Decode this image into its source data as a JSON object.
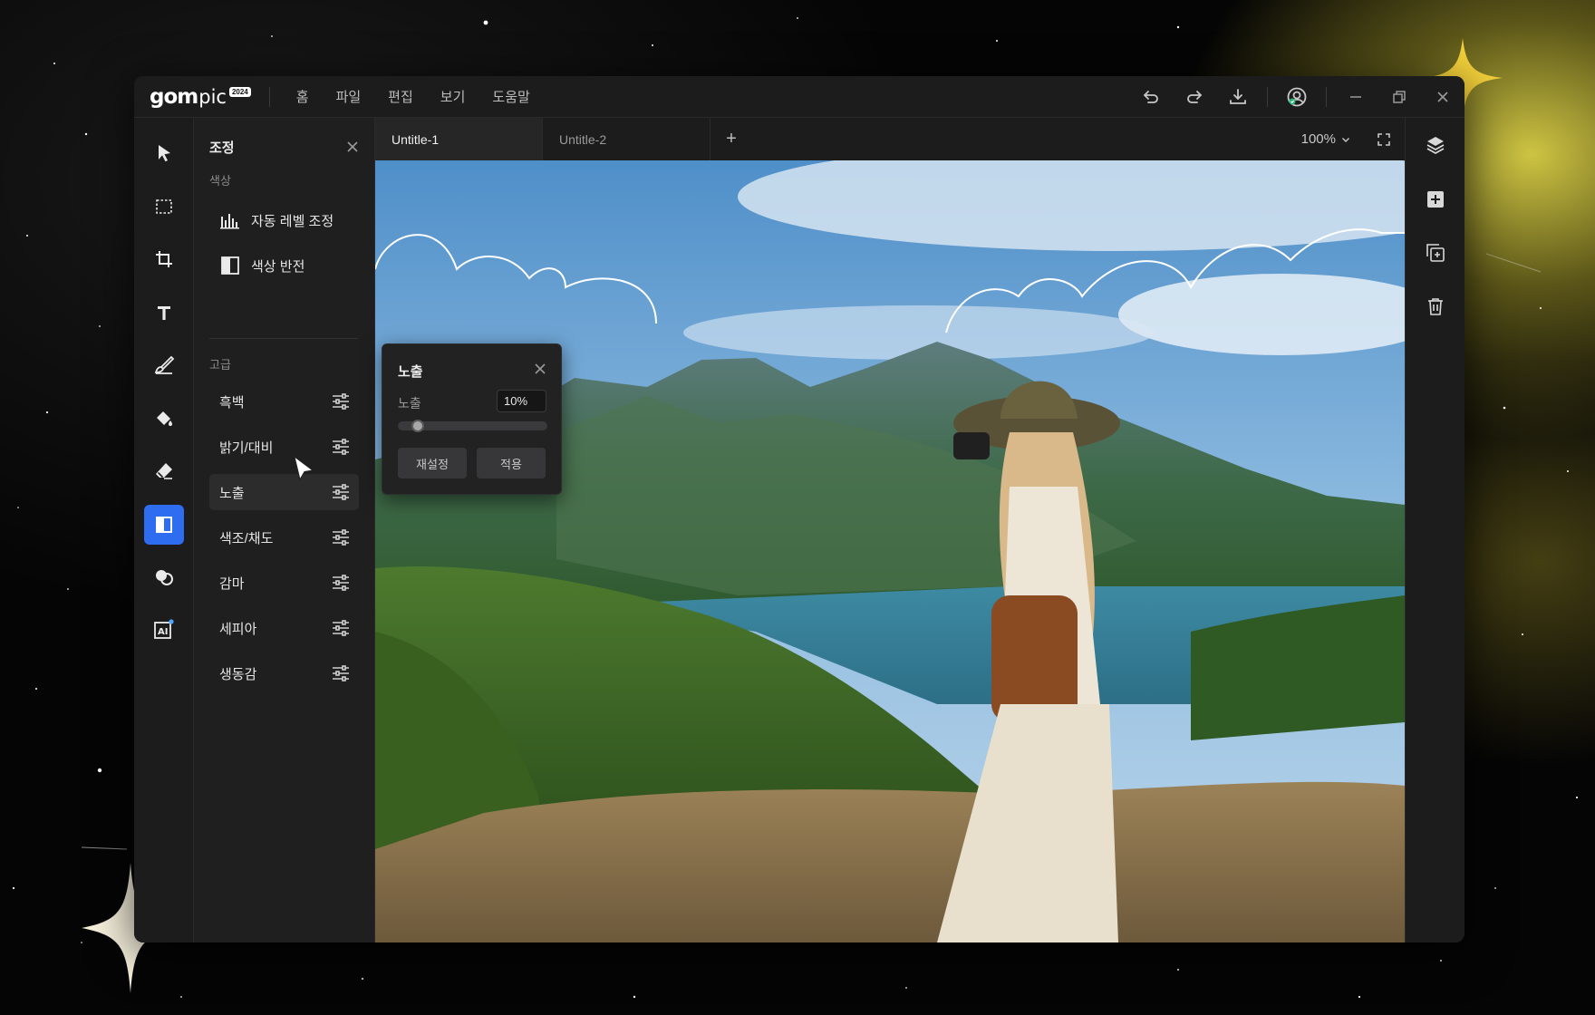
{
  "app": {
    "logo_text": "gom",
    "logo_suffix": "pic",
    "logo_badge": "2024"
  },
  "menu": [
    "홈",
    "파일",
    "편집",
    "보기",
    "도움말"
  ],
  "titlebar_icons": [
    "undo-icon",
    "redo-icon",
    "download-icon",
    "account-icon",
    "minimize-icon",
    "restore-icon",
    "close-icon"
  ],
  "tools": [
    "select-arrow-icon",
    "marquee-select-icon",
    "crop-icon",
    "text-icon",
    "brush-icon",
    "fill-bucket-icon",
    "eraser-icon",
    "adjust-icon",
    "filter-circles-icon",
    "ai-icon"
  ],
  "active_tool": "adjust-icon",
  "panel": {
    "title": "조정",
    "section_color": "색상",
    "color_items": [
      {
        "label": "자동 레벨 조정",
        "icon": "levels-icon"
      },
      {
        "label": "색상 반전",
        "icon": "invert-icon"
      }
    ],
    "section_advanced": "고급",
    "advanced_items": [
      {
        "label": "흑백"
      },
      {
        "label": "밝기/대비"
      },
      {
        "label": "노출"
      },
      {
        "label": "색조/채도"
      },
      {
        "label": "감마"
      },
      {
        "label": "세피아"
      },
      {
        "label": "생동감"
      }
    ],
    "hovered_item": "노출"
  },
  "tabs": [
    {
      "label": "Untitle-1",
      "active": true
    },
    {
      "label": "Untitle-2",
      "active": false
    }
  ],
  "tab_add": "+",
  "zoom": "100%",
  "right_icons": [
    "layers-icon",
    "add-layer-icon",
    "duplicate-layer-icon",
    "delete-icon"
  ],
  "exposure_popup": {
    "title": "노출",
    "label": "노출",
    "value": "10%",
    "slider_fraction": 0.1,
    "reset_label": "재설정",
    "apply_label": "적용"
  },
  "colors": {
    "accent": "#2f6df0",
    "window_bg": "#1e1e1f",
    "panel_bg": "#1f1f20",
    "sparkle_yellow": "#f2cf3a",
    "sparkle_cream": "#f6f0dc"
  }
}
